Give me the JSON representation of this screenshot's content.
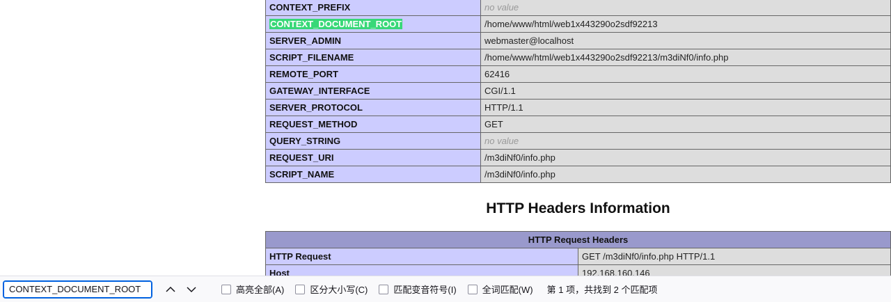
{
  "env_rows": [
    {
      "name": "CONTEXT_PREFIX",
      "value": "no value",
      "novalue": true
    },
    {
      "name": "CONTEXT_DOCUMENT_ROOT",
      "value": "/home/www/html/web1x443290o2sdf92213",
      "highlighted": true
    },
    {
      "name": "SERVER_ADMIN",
      "value": "webmaster@localhost"
    },
    {
      "name": "SCRIPT_FILENAME",
      "value": "/home/www/html/web1x443290o2sdf92213/m3diNf0/info.php"
    },
    {
      "name": "REMOTE_PORT",
      "value": "62416"
    },
    {
      "name": "GATEWAY_INTERFACE",
      "value": "CGI/1.1"
    },
    {
      "name": "SERVER_PROTOCOL",
      "value": "HTTP/1.1"
    },
    {
      "name": "REQUEST_METHOD",
      "value": "GET"
    },
    {
      "name": "QUERY_STRING",
      "value": "no value",
      "novalue": true
    },
    {
      "name": "REQUEST_URI",
      "value": "/m3diNf0/info.php"
    },
    {
      "name": "SCRIPT_NAME",
      "value": "/m3diNf0/info.php"
    }
  ],
  "http_headers": {
    "title": "HTTP Headers Information",
    "table_header": "HTTP Request Headers",
    "rows": [
      {
        "name": "HTTP Request",
        "value": "GET /m3diNf0/info.php HTTP/1.1"
      },
      {
        "name": "Host",
        "value": "192.168.160.146"
      }
    ]
  },
  "findbar": {
    "query": "CONTEXT_DOCUMENT_ROOT",
    "highlight_all_label": "高亮全部(A)",
    "match_case_label": "区分大小写(C)",
    "match_diacritics_label": "匹配变音符号(I)",
    "whole_words_label": "全词匹配(W)",
    "status": "第 1 项，共找到 2 个匹配项"
  },
  "colors": {
    "label_cell": "#ccccff",
    "value_cell": "#dddddd",
    "table_header": "#9999cc",
    "find_highlight": "#38d878",
    "find_input_border": "#0061e0"
  }
}
